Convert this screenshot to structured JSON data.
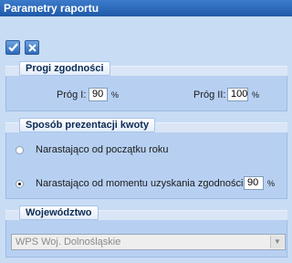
{
  "window": {
    "title": "Parametry raportu"
  },
  "toolbar": {
    "ok_icon": "checkmark-icon",
    "cancel_icon": "close-icon"
  },
  "thresholds": {
    "legend": "Progi zgodności",
    "prog1": {
      "label": "Próg I:",
      "value": "90",
      "unit": "%"
    },
    "prog2": {
      "label": "Próg II:",
      "value": "100",
      "unit": "%"
    }
  },
  "presentation": {
    "legend": "Sposób prezentacji kwoty",
    "option1": {
      "label": "Narastająco od początku roku",
      "selected": false
    },
    "option2": {
      "label": "Narastająco od momentu uzyskania zgodności",
      "selected": true,
      "value": "90",
      "unit": "%"
    }
  },
  "voivodeship": {
    "legend": "Województwo",
    "selected": "WPS Woj. Dolnośląskie"
  },
  "colors": {
    "titlebar": "#2a64b6",
    "panel": "#b7d0f2",
    "background": "#c8dcf4"
  }
}
